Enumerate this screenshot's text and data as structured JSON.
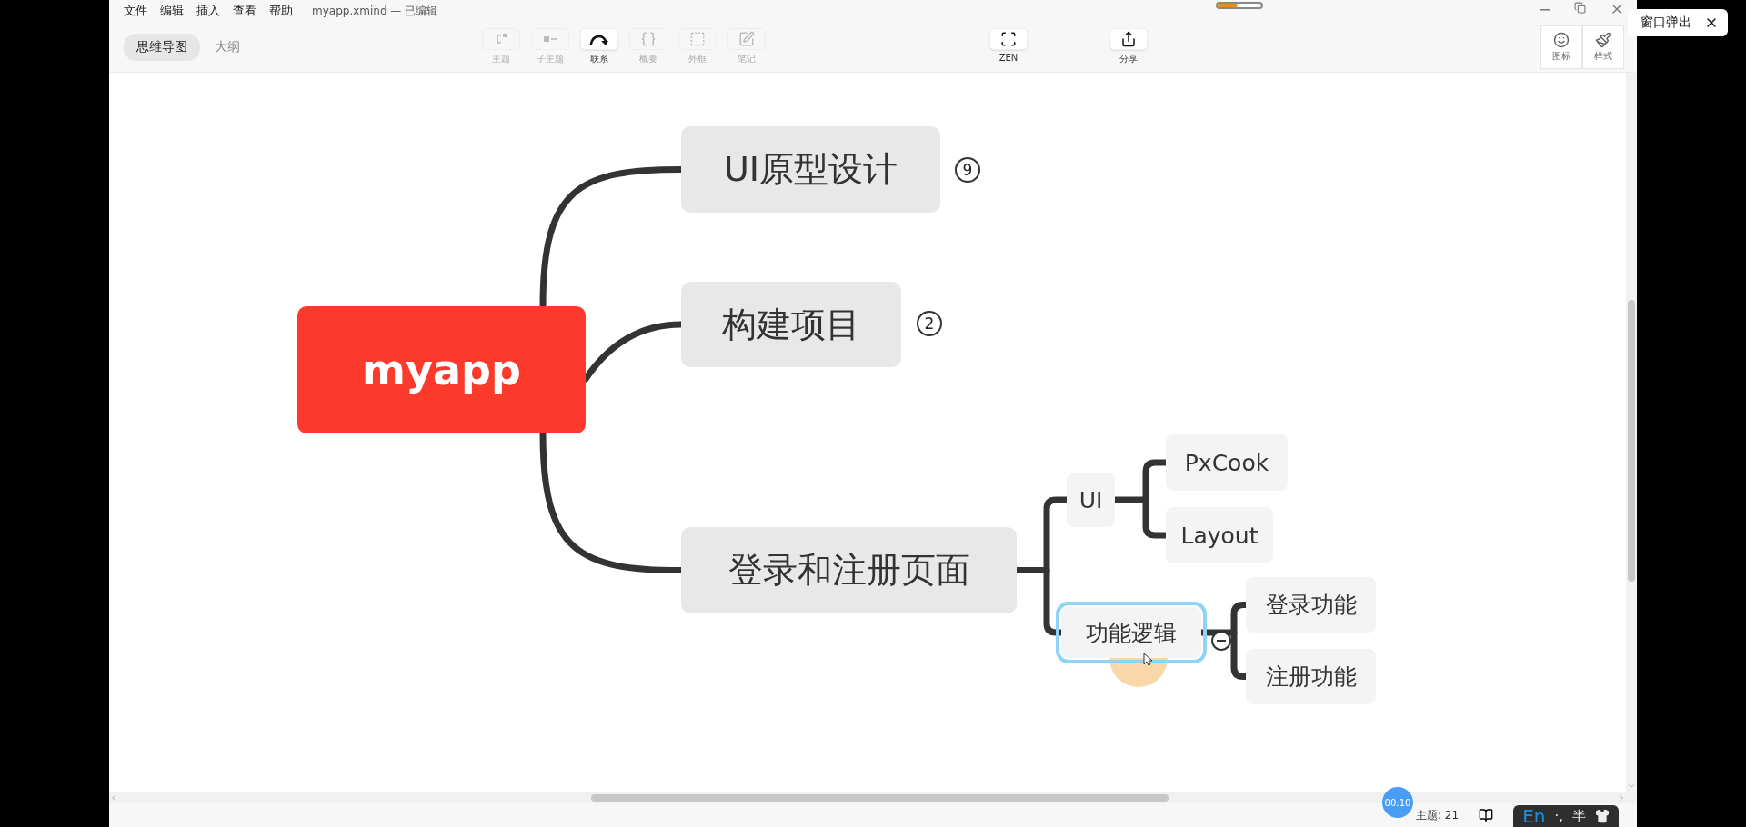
{
  "menu": [
    "文件",
    "编辑",
    "插入",
    "查看",
    "帮助"
  ],
  "document_title": "myapp.xmind — 已编辑",
  "progress": {
    "level": 0.45
  },
  "view_tabs": [
    {
      "label": "思维导图",
      "selected": true
    },
    {
      "label": "大纲",
      "selected": false
    }
  ],
  "toolbar": [
    {
      "kind": "topic",
      "label": "主题",
      "disabled": true
    },
    {
      "kind": "subtopic",
      "label": "子主题",
      "disabled": true
    },
    {
      "kind": "relation",
      "label": "联系",
      "disabled": false
    },
    {
      "kind": "summary",
      "label": "概要",
      "disabled": true
    },
    {
      "kind": "boundary",
      "label": "外框",
      "disabled": true
    },
    {
      "kind": "note",
      "label": "笔记",
      "disabled": true
    }
  ],
  "right_tools": [
    {
      "kind": "zen",
      "label": "ZEN"
    },
    {
      "kind": "share",
      "label": "分享"
    }
  ],
  "side_tools": [
    {
      "kind": "icon",
      "label": "图标"
    },
    {
      "kind": "style",
      "label": "样式"
    }
  ],
  "popup": {
    "label": "窗口弹出"
  },
  "mindmap": {
    "root": "myapp",
    "children": [
      {
        "label": "UI原型设计",
        "collapsed_count": "9"
      },
      {
        "label": "构建项目",
        "collapsed_count": "2"
      },
      {
        "label": "登录和注册页面",
        "children": [
          {
            "label": "UI",
            "selected": false,
            "children": [
              {
                "label": "PxCook"
              },
              {
                "label": "Layout"
              }
            ]
          },
          {
            "label": "功能逻辑",
            "selected": true,
            "expanded": true,
            "children": [
              {
                "label": "登录功能"
              },
              {
                "label": "注册功能"
              }
            ]
          }
        ]
      }
    ]
  },
  "status_bar": {
    "topic_count": "主题: 21"
  },
  "recording_timer": "00:10",
  "ime": {
    "items": [
      "En",
      "·,",
      "半"
    ]
  }
}
